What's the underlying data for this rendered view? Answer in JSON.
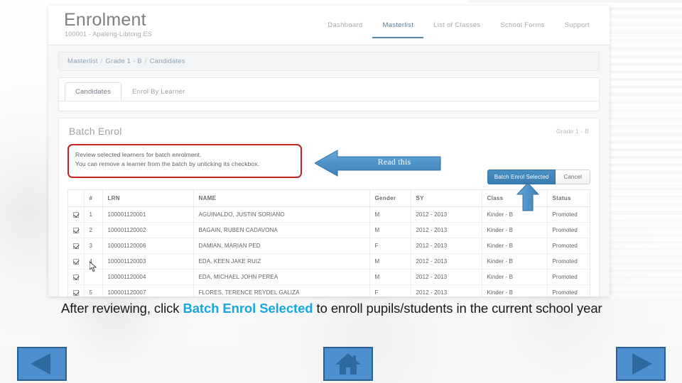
{
  "app": {
    "title": "Enrolment",
    "subtitle": "100001 - Apaleng-Libtong ES",
    "nav": [
      {
        "label": "Dashboard",
        "active": false
      },
      {
        "label": "Masterlist",
        "active": true
      },
      {
        "label": "List of Classes",
        "active": false
      },
      {
        "label": "School Forms",
        "active": false
      },
      {
        "label": "Support",
        "active": false
      }
    ],
    "breadcrumb": {
      "item1": "Masterlist",
      "item2": "Grade 1 - B",
      "item3": "Candidates",
      "separator": "/"
    },
    "tabs": [
      {
        "label": "Candidates",
        "active": true
      },
      {
        "label": "Enrol By Learner",
        "active": false
      }
    ],
    "panel": {
      "title": "Batch Enrol",
      "grade_label": "Grade 1 - B",
      "alert_line1": "Review selected learners for batch enrolment.",
      "alert_line2": "You can remove a learner from the batch by unticking its checkbox.",
      "primary_button": "Batch Enrol Selected",
      "cancel_button": "Cancel"
    },
    "table": {
      "headers": {
        "checkbox": "",
        "number": "#",
        "lrn": "LRN",
        "name": "NAME",
        "gender": "Gender",
        "sy": "SY",
        "class": "Class",
        "status": "Status"
      },
      "rows": [
        {
          "checked": true,
          "num": "1",
          "lrn": "100001120001",
          "name": "AGUINALDO, JUSTIN SORIANO",
          "gender": "M",
          "sy": "2012 - 2013",
          "class": "Kinder - B",
          "status": "Promoted"
        },
        {
          "checked": true,
          "num": "2",
          "lrn": "100001120002",
          "name": "BAGAIN, RUBEN CADAVONA",
          "gender": "M",
          "sy": "2012 - 2013",
          "class": "Kinder - B",
          "status": "Promoted"
        },
        {
          "checked": true,
          "num": "3",
          "lrn": "100001120006",
          "name": "DAMIAN, MARIAN PED",
          "gender": "F",
          "sy": "2012 - 2013",
          "class": "Kinder - B",
          "status": "Promoted"
        },
        {
          "checked": true,
          "num": "4",
          "lrn": "100001120003",
          "name": "EDA, KEEN JAKE RUIZ",
          "gender": "M",
          "sy": "2012 - 2013",
          "class": "Kinder - B",
          "status": "Promoted"
        },
        {
          "checked": true,
          "num": "",
          "lrn": "100001120004",
          "name": "EDA, MICHAEL JOHN PEREA",
          "gender": "M",
          "sy": "2012 - 2013",
          "class": "Kinder - B",
          "status": "Promoted"
        },
        {
          "checked": true,
          "num": "5",
          "lrn": "100001120007",
          "name": "FLORES, TERENCE REYDEL GALIZA",
          "gender": "F",
          "sy": "2012 - 2013",
          "class": "Kinder - B",
          "status": "Promoted"
        }
      ]
    }
  },
  "annotations": {
    "read_this_label": "Read this",
    "arrow_color": "#4a90c4"
  },
  "caption": {
    "part1": "After reviewing, click ",
    "highlight": "Batch Enrol Selected",
    "part2": " to enroll pupils/students in the current school year",
    "highlight_color": "#19a8dd"
  },
  "slide_nav": {
    "previous": "previous-slide",
    "home": "home-slide",
    "next": "next-slide"
  }
}
